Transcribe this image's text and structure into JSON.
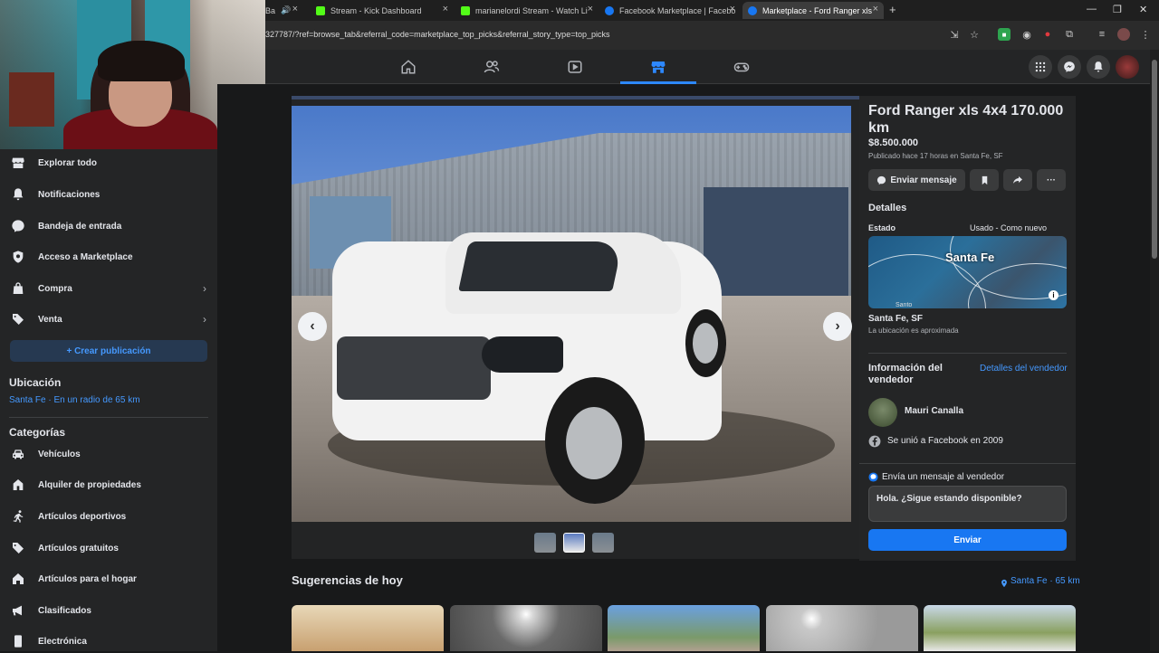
{
  "browser": {
    "tabs": [
      {
        "label": "Ba",
        "icon": "generic-tab-icon"
      },
      {
        "label": "Stream - Kick Dashboard",
        "icon": "kick-icon"
      },
      {
        "label": "marianelordi Stream - Watch Li",
        "icon": "kick-icon"
      },
      {
        "label": "Facebook Marketplace | Facebo",
        "icon": "facebook-icon"
      },
      {
        "label": "Marketplace - Ford Ranger xls",
        "icon": "facebook-icon"
      }
    ],
    "url": "327787/?ref=browse_tab&referral_code=marketplace_top_picks&referral_story_type=top_picks"
  },
  "sidebar": {
    "items": [
      {
        "label": "Explorar todo",
        "icon": "store-icon"
      },
      {
        "label": "Notificaciones",
        "icon": "bell-icon"
      },
      {
        "label": "Bandeja de entrada",
        "icon": "inbox-icon"
      },
      {
        "label": "Acceso a Marketplace",
        "icon": "shield-icon"
      },
      {
        "label": "Compra",
        "icon": "bag-icon"
      },
      {
        "label": "Venta",
        "icon": "tag-icon"
      }
    ],
    "create_button": "+ Crear publicación",
    "location_heading": "Ubicación",
    "location_value": "Santa Fe · En un radio de 65 km",
    "categories_heading": "Categorías",
    "categories": [
      {
        "label": "Vehículos",
        "icon": "car-icon"
      },
      {
        "label": "Alquiler de propiedades",
        "icon": "house-icon"
      },
      {
        "label": "Artículos deportivos",
        "icon": "run-icon"
      },
      {
        "label": "Artículos gratuitos",
        "icon": "tag-free-icon"
      },
      {
        "label": "Artículos para el hogar",
        "icon": "home-icon"
      },
      {
        "label": "Clasificados",
        "icon": "megaphone-icon"
      },
      {
        "label": "Electrónica",
        "icon": "phone-icon"
      }
    ]
  },
  "listing": {
    "title": "Ford Ranger xls 4x4 170.000 km",
    "price": "$8.500.000",
    "posted": "Publicado hace 17 horas en Santa Fe, SF",
    "message_button": "Enviar mensaje",
    "details_heading": "Detalles",
    "condition_label": "Estado",
    "condition_value": "Usado - Como nuevo",
    "map_label": "Santa Fe",
    "map_small_label": "Santo",
    "location": "Santa Fe, SF",
    "location_note": "La ubicación es aproximada",
    "seller_heading": "Información del vendedor",
    "seller_details_link": "Detalles del vendedor",
    "seller_name": "Mauri Canalla",
    "seller_joined": "Se unió a Facebook en 2009",
    "message_prompt": "Envía un mensaje al vendedor",
    "message_text": "Hola. ¿Sigue estando disponible?",
    "send_button": "Enviar"
  },
  "suggestions": {
    "heading": "Sugerencias de hoy",
    "location": "Santa Fe · 65 km"
  },
  "colors": {
    "accent": "#1877f2",
    "link": "#4599ff",
    "background": "#18191a",
    "surface": "#242526"
  }
}
